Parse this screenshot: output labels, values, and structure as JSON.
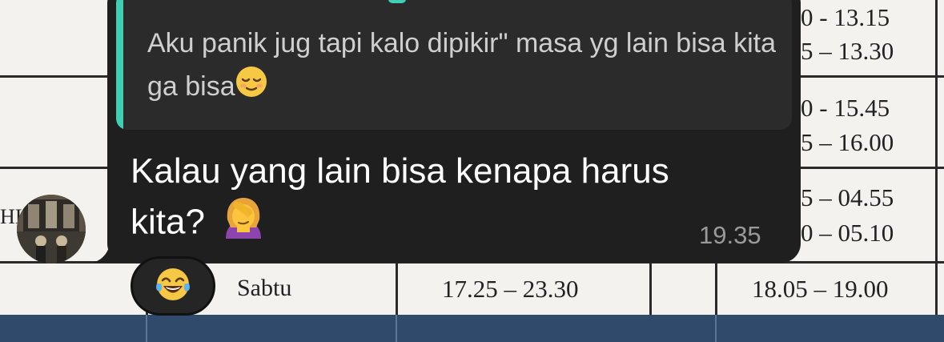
{
  "background_table": {
    "row1_times": [
      "0 - 13.15",
      "5 – 13.30"
    ],
    "row2_times": [
      "0 - 15.45",
      "5 – 16.00"
    ],
    "row3_times": [
      "5 – 04.55",
      "0 – 05.10"
    ],
    "row3_left_fragment": "HI",
    "row4": {
      "day": "Sabtu",
      "time_a": "17.25 – 23.30",
      "time_b": "18.05 – 19.00"
    }
  },
  "message": {
    "reply_quote": "Aku panik jug tapi kalo dipikir\" masa yg lain bisa kita ga bisa",
    "reply_emoji": "relieved-face",
    "text_line1": "Kalau yang lain bisa kenapa harus",
    "text_line2": "kita?",
    "inline_emoji": "person-facepalming",
    "time": "19.35",
    "reaction_emoji": "face-with-tears-of-joy"
  },
  "colors": {
    "bubble": "#1f1f1f",
    "reply_box": "#2b2b2b",
    "reply_accent": "#3fcfb3",
    "time_text": "#9a9a9a"
  }
}
